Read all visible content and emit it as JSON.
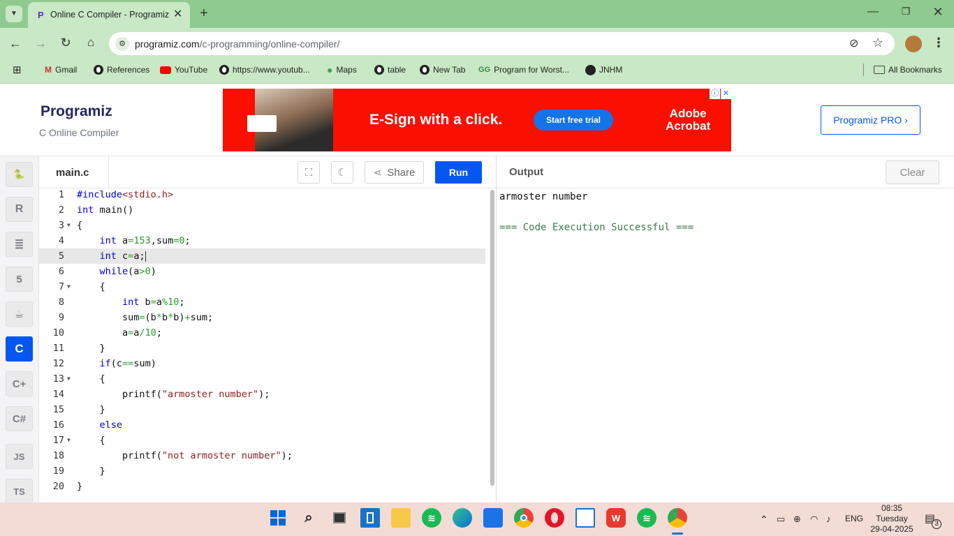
{
  "browser": {
    "tab_title": "Online C Compiler - Programiz",
    "url_domain": "programiz.com",
    "url_path": "/c-programming/online-compiler/",
    "bookmarks": [
      "Gmail",
      "References",
      "YouTube",
      "https://www.youtub...",
      "Maps",
      "table",
      "New Tab",
      "Program for Worst...",
      "JNHM"
    ],
    "all_bookmarks": "All Bookmarks",
    "new_tab_symbol": "+",
    "menu_symbol": "⋮"
  },
  "site": {
    "logo": "Programiz",
    "subtitle": "C Online Compiler",
    "pro_button": "Programiz PRO ›"
  },
  "ad": {
    "headline": "E-Sign with a click.",
    "cta": "Start free trial",
    "brand_line1": "Adobe",
    "brand_line2": "Acrobat"
  },
  "sidebar": {
    "languages": [
      "python",
      "r",
      "sql",
      "html",
      "java",
      "c",
      "cpp",
      "csharp",
      "JS",
      "TS"
    ]
  },
  "editor": {
    "filename": "main.c",
    "share_label": "Share",
    "run_label": "Run",
    "line_numbers": [
      "1",
      "2",
      "3",
      "4",
      "5",
      "6",
      "7",
      "8",
      "9",
      "10",
      "11",
      "12",
      "13",
      "14",
      "15",
      "16",
      "17",
      "18",
      "19",
      "20"
    ]
  },
  "output": {
    "title": "Output",
    "clear_label": "Clear",
    "lines": [
      "armoster number",
      "",
      "=== Code Execution Successful ==="
    ]
  },
  "taskbar": {
    "language": "ENG",
    "time": "08:35",
    "day": "Tuesday",
    "date": "29-04-2025",
    "notification_count": "3"
  },
  "colors": {
    "accent": "#0556f3",
    "chrome_green": "#8fca8f",
    "chrome_light": "#c9e8c5",
    "ad_red": "#fa0f00"
  }
}
